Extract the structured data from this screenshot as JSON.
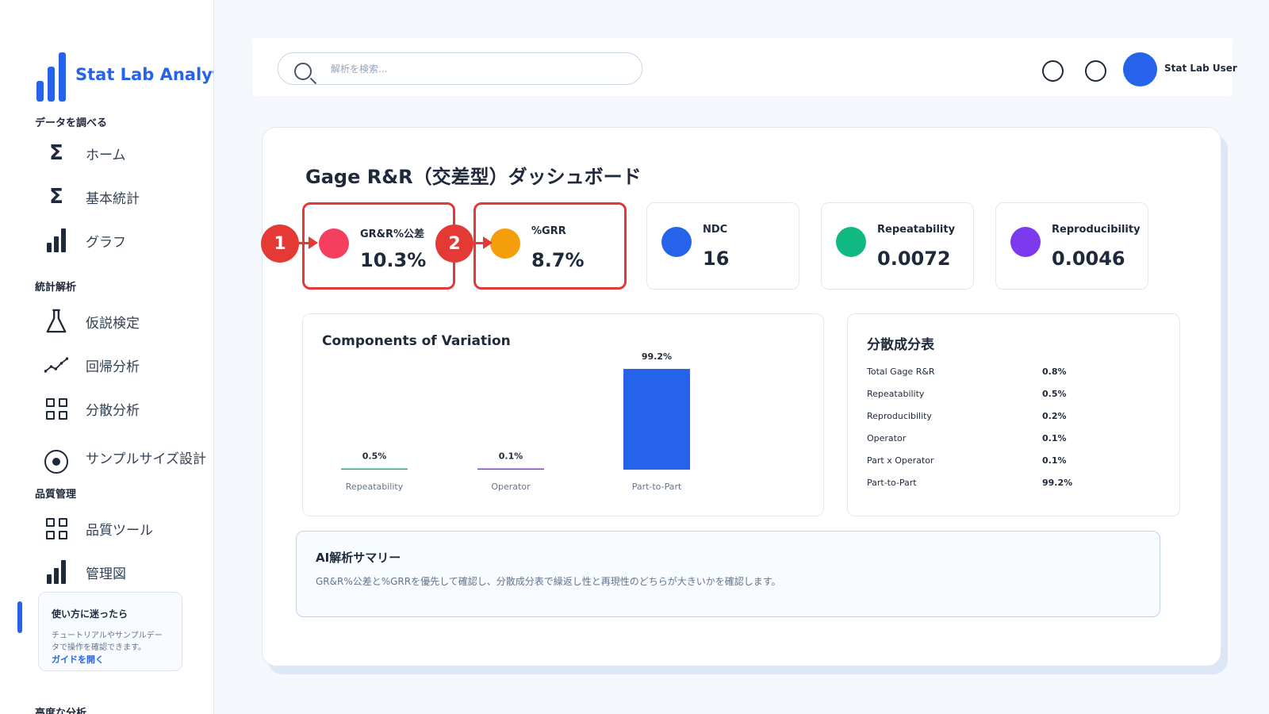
{
  "sidebar": {
    "brand": "Stat Lab Analytics",
    "sections": [
      {
        "label": "データを調べる"
      },
      {
        "label": "統計解析"
      },
      {
        "label": "品質管理"
      },
      {
        "label": "高度な分析"
      }
    ],
    "items": [
      {
        "label": "ホーム",
        "icon": "sigma-icon"
      },
      {
        "label": "基本統計",
        "icon": "sigma-icon"
      },
      {
        "label": "グラフ",
        "icon": "bar-chart-icon"
      },
      {
        "label": "仮説検定",
        "icon": "flask-icon"
      },
      {
        "label": "回帰分析",
        "icon": "trend-line-icon"
      },
      {
        "label": "分散分析",
        "icon": "grid-icon"
      },
      {
        "label": "サンプルサイズ設計",
        "icon": "target-icon"
      },
      {
        "label": "品質ツール",
        "icon": "grid-icon"
      },
      {
        "label": "管理図",
        "icon": "bar-chart-icon"
      }
    ],
    "help": {
      "title": "使い方に迷ったら",
      "text": "チュートリアルやサンプルデータで操作を確認できます。",
      "link": "ガイドを開く"
    }
  },
  "header": {
    "search_placeholder": "解析を検索...",
    "user_name": "Stat Lab User"
  },
  "page": {
    "title": "Gage R&R（交差型）ダッシュボード"
  },
  "kpis": [
    {
      "label": "GR&R%公差",
      "value": "10.3%",
      "color": "#f43f5e",
      "annotation": "1"
    },
    {
      "label": "%GRR",
      "value": "8.7%",
      "color": "#f59e0b",
      "annotation": "2"
    },
    {
      "label": "NDC",
      "value": "16",
      "color": "#2563eb"
    },
    {
      "label": "Repeatability",
      "value": "0.0072",
      "color": "#10b981"
    },
    {
      "label": "Reproducibility",
      "value": "0.0046",
      "color": "#7c3aed"
    }
  ],
  "chart_data": {
    "type": "bar",
    "title": "Components of Variation",
    "categories": [
      "Repeatability",
      "Operator",
      "Part-to-Part"
    ],
    "values": [
      0.5,
      0.1,
      99.2
    ],
    "value_labels": [
      "0.5%",
      "0.1%",
      "99.2%"
    ],
    "colors": [
      "#10b981",
      "#7c3aed",
      "#2563eb"
    ],
    "ylim": [
      0,
      100
    ],
    "grid": false
  },
  "variance_table": {
    "title": "分散成分表",
    "rows": [
      {
        "name": "Total Gage R&R",
        "value": "0.8%"
      },
      {
        "name": "Repeatability",
        "value": "0.5%"
      },
      {
        "name": "Reproducibility",
        "value": "0.2%"
      },
      {
        "name": "Operator",
        "value": "0.1%"
      },
      {
        "name": "Part x Operator",
        "value": "0.1%"
      },
      {
        "name": "Part-to-Part",
        "value": "99.2%"
      }
    ]
  },
  "summary": {
    "title": "AI解析サマリー",
    "text": "GR&R%公差と%GRRを優先して確認し、分散成分表で繰返し性と再現性のどちらが大きいかを確認します。"
  }
}
